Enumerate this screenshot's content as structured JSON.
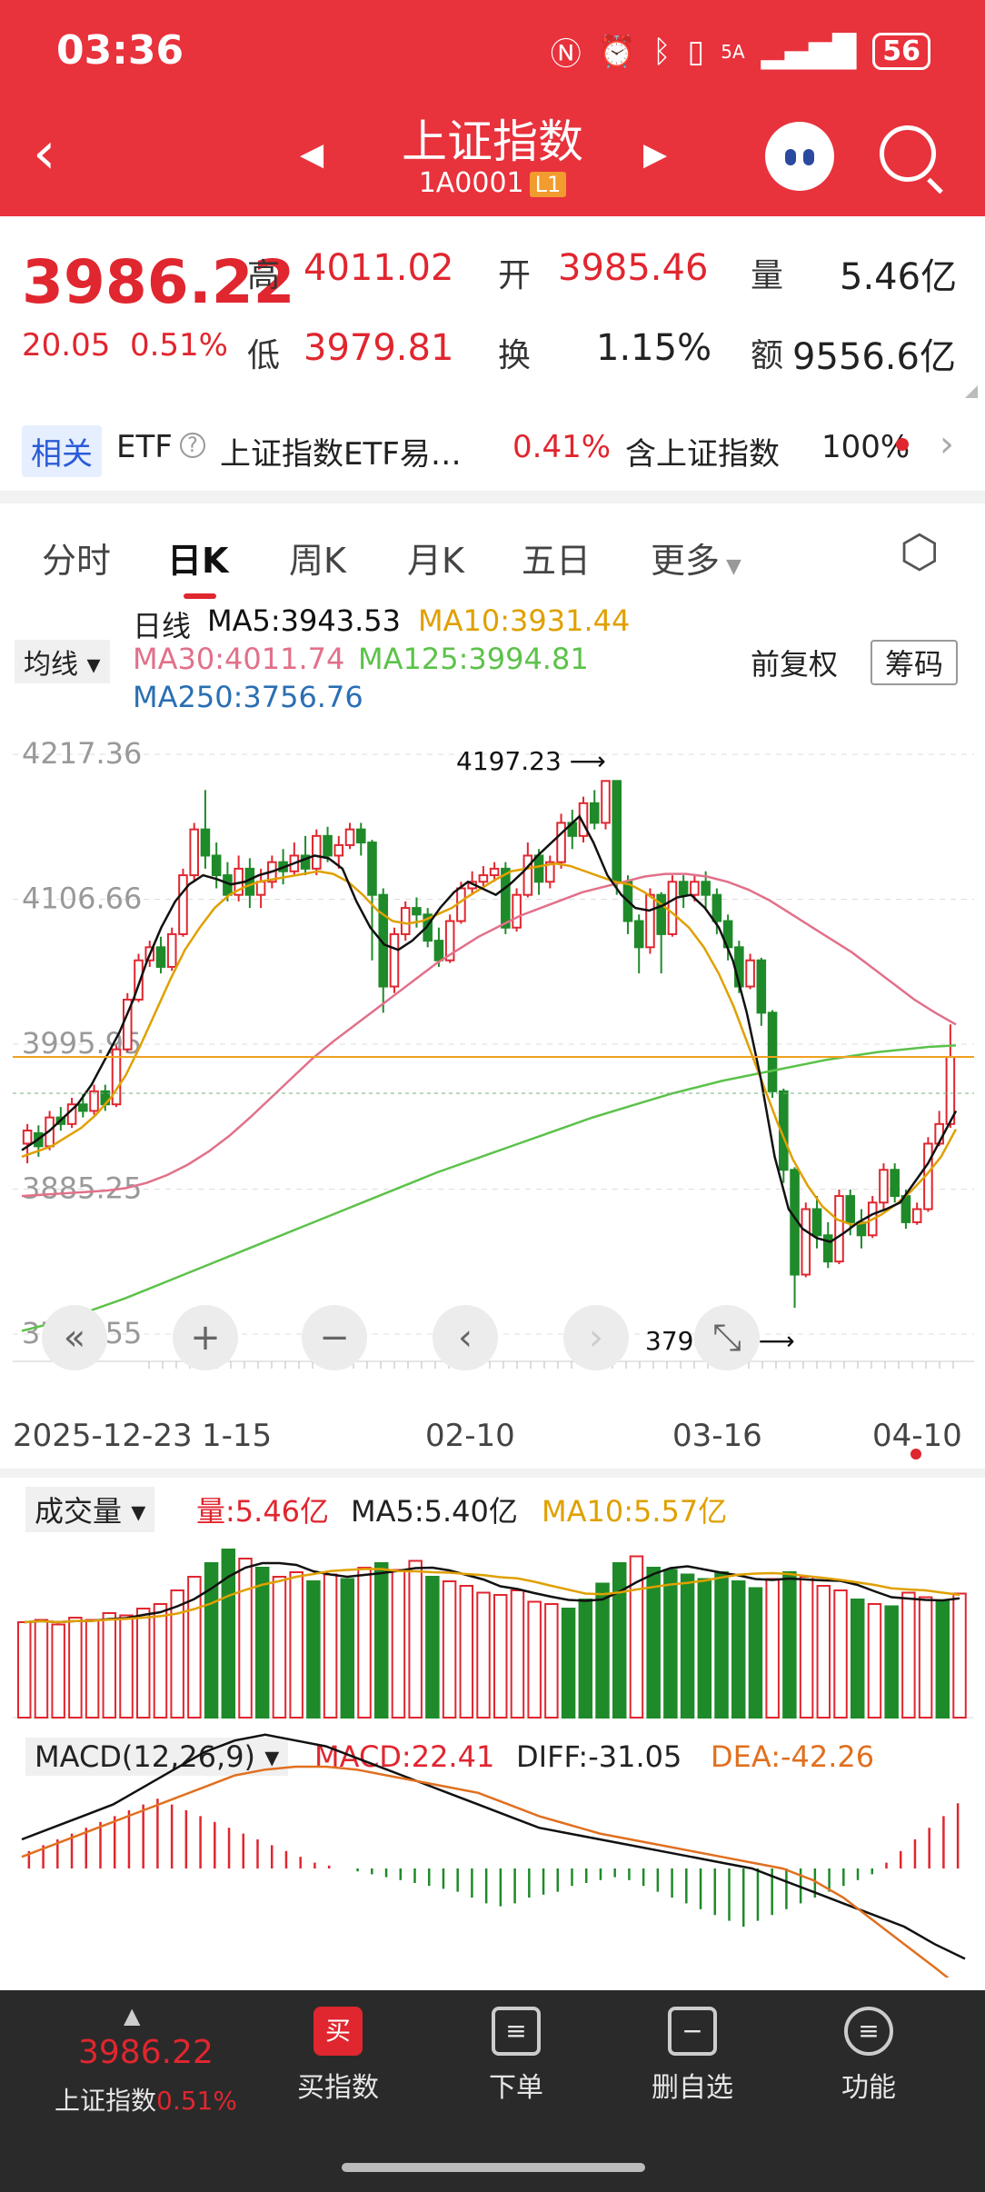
{
  "status": {
    "time": "03:36",
    "icons": [
      "nfc-icon",
      "alarm-icon",
      "bluetooth-icon",
      "vibrate-icon",
      "signal-icon"
    ],
    "net": "5A",
    "battery": "56"
  },
  "header": {
    "title": "上证指数",
    "code": "1A0001",
    "level": "L1"
  },
  "quote": {
    "price": "3986.22",
    "change": "20.05",
    "change_pct": "0.51%",
    "high_label": "高",
    "high": "4011.02",
    "open_label": "开",
    "open": "3985.46",
    "vol_label": "量",
    "vol": "5.46亿",
    "low_label": "低",
    "low": "3979.81",
    "turn_label": "换",
    "turn": "1.15%",
    "amt_label": "额",
    "amt": "9556.6亿"
  },
  "related": {
    "tag": "相关",
    "etf": "ETF",
    "name": "上证指数ETF易…",
    "pct": "0.41%",
    "contains": "含上证指数",
    "weight": "100%"
  },
  "tabs": [
    "分时",
    "日K",
    "周K",
    "月K",
    "五日",
    "更多"
  ],
  "legend": {
    "line_label": "日线",
    "ma5": "MA5:3943.53",
    "ma10": "MA10:3931.44",
    "ma30": "MA30:4011.74",
    "ma125": "MA125:3994.81",
    "ma250": "MA250:3756.76",
    "ma_select": "均线",
    "adjust": "前复权",
    "chips": "筹码"
  },
  "colors": {
    "up": "#e0262f",
    "down": "#1f8a2a",
    "ma5": "#111111",
    "ma10": "#e0a000",
    "ma30": "#e2708a",
    "ma125": "#5cc24a",
    "ma250": "#2a6fb3",
    "header": "#e8323c"
  },
  "chart_data": [
    {
      "type": "candlestick",
      "title": "上证指数 日K",
      "y_ticks": [
        "4217.36",
        "4106.66",
        "3995.95",
        "3885.25",
        "3774.55"
      ],
      "ylim": [
        3774.55,
        4217.36
      ],
      "x_labels": [
        "2025-12-23",
        "1-15",
        "02-10",
        "03-16",
        "04-10"
      ],
      "annotations": [
        {
          "text": "4197.23",
          "value": 4197.23
        },
        {
          "text": "3794.68",
          "value": 3794.68
        }
      ],
      "last_price_line": 3986.22,
      "candles": [
        [
          3920,
          3930,
          3905,
          3935
        ],
        [
          3928,
          3918,
          3910,
          3934
        ],
        [
          3918,
          3940,
          3915,
          3945
        ],
        [
          3940,
          3935,
          3930,
          3948
        ],
        [
          3935,
          3950,
          3932,
          3955
        ],
        [
          3950,
          3945,
          3940,
          3958
        ],
        [
          3945,
          3960,
          3942,
          3965
        ],
        [
          3960,
          3950,
          3945,
          3965
        ],
        [
          3950,
          3992,
          3948,
          3995
        ],
        [
          3992,
          4030,
          3990,
          4035
        ],
        [
          4030,
          4060,
          4028,
          4065
        ],
        [
          4060,
          4070,
          4055,
          4075
        ],
        [
          4070,
          4055,
          4050,
          4078
        ],
        [
          4055,
          4080,
          4052,
          4085
        ],
        [
          4080,
          4125,
          4078,
          4130
        ],
        [
          4125,
          4160,
          4120,
          4165
        ],
        [
          4160,
          4140,
          4130,
          4190
        ],
        [
          4140,
          4125,
          4115,
          4150
        ],
        [
          4125,
          4110,
          4105,
          4135
        ],
        [
          4110,
          4130,
          4105,
          4140
        ],
        [
          4130,
          4110,
          4100,
          4138
        ],
        [
          4110,
          4120,
          4100,
          4130
        ],
        [
          4120,
          4135,
          4115,
          4140
        ],
        [
          4135,
          4128,
          4118,
          4145
        ],
        [
          4128,
          4140,
          4125,
          4150
        ],
        [
          4140,
          4130,
          4125,
          4155
        ],
        [
          4130,
          4155,
          4125,
          4160
        ],
        [
          4155,
          4140,
          4135,
          4162
        ],
        [
          4140,
          4148,
          4130,
          4155
        ],
        [
          4148,
          4160,
          4145,
          4165
        ],
        [
          4160,
          4150,
          4140,
          4165
        ],
        [
          4150,
          4110,
          4060,
          4152
        ],
        [
          4110,
          4040,
          4020,
          4115
        ],
        [
          4040,
          4080,
          4035,
          4085
        ],
        [
          4080,
          4100,
          4075,
          4105
        ],
        [
          4100,
          4095,
          4085,
          4108
        ],
        [
          4095,
          4075,
          4070,
          4100
        ],
        [
          4075,
          4060,
          4055,
          4085
        ],
        [
          4060,
          4090,
          4058,
          4095
        ],
        [
          4090,
          4115,
          4088,
          4120
        ],
        [
          4115,
          4120,
          4110,
          4128
        ],
        [
          4120,
          4125,
          4115,
          4132
        ],
        [
          4125,
          4130,
          4120,
          4135
        ],
        [
          4130,
          4085,
          4080,
          4135
        ],
        [
          4085,
          4110,
          4082,
          4115
        ],
        [
          4110,
          4140,
          4108,
          4150
        ],
        [
          4140,
          4120,
          4110,
          4145
        ],
        [
          4120,
          4135,
          4115,
          4140
        ],
        [
          4135,
          4165,
          4130,
          4172
        ],
        [
          4165,
          4155,
          4145,
          4175
        ],
        [
          4155,
          4180,
          4150,
          4185
        ],
        [
          4180,
          4165,
          4160,
          4190
        ],
        [
          4165,
          4197,
          4160,
          4197
        ],
        [
          4197,
          4120,
          4110,
          4197
        ],
        [
          4120,
          4090,
          4080,
          4125
        ],
        [
          4090,
          4070,
          4050,
          4095
        ],
        [
          4070,
          4110,
          4065,
          4115
        ],
        [
          4110,
          4080,
          4050,
          4112
        ],
        [
          4080,
          4120,
          4078,
          4125
        ],
        [
          4120,
          4110,
          4100,
          4125
        ],
        [
          4110,
          4120,
          4105,
          4125
        ],
        [
          4120,
          4110,
          4100,
          4128
        ],
        [
          4110,
          4090,
          4080,
          4115
        ],
        [
          4090,
          4070,
          4060,
          4095
        ],
        [
          4070,
          4040,
          4035,
          4075
        ],
        [
          4040,
          4060,
          4038,
          4065
        ],
        [
          4060,
          4020,
          4010,
          4062
        ],
        [
          4020,
          3960,
          3955,
          4022
        ],
        [
          3960,
          3900,
          3890,
          3962
        ],
        [
          3900,
          3820,
          3794.68,
          3902
        ],
        [
          3820,
          3870,
          3818,
          3875
        ],
        [
          3870,
          3850,
          3840,
          3880
        ],
        [
          3850,
          3830,
          3825,
          3860
        ],
        [
          3830,
          3880,
          3828,
          3885
        ],
        [
          3880,
          3860,
          3850,
          3885
        ],
        [
          3860,
          3850,
          3840,
          3870
        ],
        [
          3850,
          3875,
          3848,
          3880
        ],
        [
          3875,
          3900,
          3870,
          3905
        ],
        [
          3900,
          3880,
          3875,
          3905
        ],
        [
          3880,
          3860,
          3855,
          3885
        ],
        [
          3860,
          3870,
          3858,
          3875
        ],
        [
          3870,
          3920,
          3868,
          3925
        ],
        [
          3920,
          3935,
          3918,
          3945
        ],
        [
          3935,
          3986.22,
          3932,
          4011.02
        ]
      ],
      "ma5": [
        3915,
        3922,
        3930,
        3940,
        3950,
        3965,
        3985,
        4005,
        4030,
        4060,
        4085,
        4105,
        4118,
        4125,
        4122,
        4118,
        4120,
        4125,
        4128,
        4132,
        4136,
        4140,
        4138,
        4130,
        4105,
        4085,
        4072,
        4068,
        4075,
        4085,
        4100,
        4112,
        4120,
        4115,
        4110,
        4118,
        4128,
        4140,
        4150,
        4160,
        4170,
        4150,
        4125,
        4110,
        4100,
        4098,
        4102,
        4108,
        4110,
        4100,
        4085,
        4060,
        4020,
        3970,
        3910,
        3870,
        3855,
        3848,
        3845,
        3852,
        3860,
        3866,
        3870,
        3875,
        3890,
        3905,
        3925,
        3945
      ],
      "ma10": [
        3910,
        3914,
        3918,
        3925,
        3932,
        3942,
        3955,
        3972,
        3995,
        4020,
        4045,
        4068,
        4085,
        4100,
        4110,
        4116,
        4120,
        4122,
        4124,
        4126,
        4128,
        4126,
        4120,
        4110,
        4098,
        4090,
        4088,
        4090,
        4095,
        4100,
        4108,
        4115,
        4122,
        4128,
        4130,
        4132,
        4134,
        4132,
        4128,
        4124,
        4120,
        4118,
        4112,
        4104,
        4095,
        4085,
        4070,
        4050,
        4025,
        3995,
        3965,
        3935,
        3908,
        3888,
        3872,
        3862,
        3858,
        3860,
        3866,
        3874,
        3884,
        3896,
        3910,
        3931
      ],
      "ma30": [
        3880,
        3881,
        3882,
        3883,
        3884,
        3886,
        3890,
        3896,
        3904,
        3914,
        3926,
        3940,
        3955,
        3970,
        3985,
        3998,
        4010,
        4022,
        4034,
        4046,
        4058,
        4068,
        4078,
        4086,
        4094,
        4100,
        4106,
        4112,
        4116,
        4120,
        4124,
        4126,
        4126,
        4124,
        4120,
        4114,
        4106,
        4096,
        4086,
        4076,
        4066,
        4054,
        4042,
        4030,
        4020,
        4011
      ],
      "ma125": [
        3777,
        3782,
        3788,
        3795,
        3802,
        3810,
        3818,
        3826,
        3834,
        3842,
        3850,
        3858,
        3866,
        3874,
        3882,
        3890,
        3898,
        3905,
        3912,
        3919,
        3926,
        3933,
        3940,
        3946,
        3952,
        3958,
        3963,
        3968,
        3972,
        3976,
        3980,
        3984,
        3987,
        3990,
        3992,
        3994,
        3995
      ],
      "ma250": [
        3756.76
      ]
    },
    {
      "type": "bar",
      "title": "成交量",
      "label": "成交量",
      "vol": "量:5.46亿",
      "ma5": "MA5:5.40亿",
      "ma10": "MA10:5.57亿",
      "values": [
        4.2,
        4.3,
        4.1,
        4.4,
        4.3,
        4.6,
        4.5,
        4.8,
        5.0,
        5.6,
        6.2,
        6.8,
        7.4,
        7.0,
        6.6,
        6.2,
        6.4,
        6.0,
        6.3,
        6.1,
        6.6,
        6.8,
        6.5,
        6.9,
        6.2,
        6.0,
        5.8,
        5.5,
        5.4,
        5.6,
        5.1,
        5.0,
        4.8,
        5.2,
        5.9,
        6.8,
        7.1,
        6.6,
        6.5,
        6.3,
        6.1,
        6.4,
        6.0,
        5.7,
        6.1,
        6.4,
        6.2,
        5.8,
        5.6,
        5.2,
        5.0,
        4.9,
        5.5,
        5.3,
        5.1,
        5.46
      ],
      "up": [
        1,
        1,
        1,
        1,
        1,
        1,
        1,
        1,
        1,
        1,
        1,
        0,
        0,
        1,
        0,
        1,
        1,
        0,
        1,
        0,
        1,
        0,
        1,
        1,
        0,
        1,
        1,
        1,
        1,
        1,
        1,
        1,
        0,
        0,
        0,
        0,
        1,
        0,
        0,
        0,
        0,
        0,
        0,
        0,
        1,
        0,
        1,
        1,
        1,
        0,
        1,
        0,
        1,
        1,
        0,
        1
      ]
    },
    {
      "type": "bar",
      "title": "MACD",
      "label": "MACD(12,26,9)",
      "macd": "MACD:22.41",
      "diff": "DIFF:-31.05",
      "dea": "DEA:-42.26",
      "hist": [
        6,
        8,
        10,
        12,
        14,
        16,
        18,
        20,
        22,
        24,
        22,
        20,
        18,
        16,
        14,
        12,
        10,
        8,
        6,
        4,
        2,
        1,
        0,
        -1,
        -2,
        -3,
        -4,
        -5,
        -6,
        -7,
        -8,
        -10,
        -12,
        -13,
        -12,
        -10,
        -9,
        -8,
        -6,
        -5,
        -4,
        -3,
        -4,
        -6,
        -8,
        -10,
        -12,
        -14,
        -16,
        -18,
        -20,
        -18,
        -16,
        -14,
        -12,
        -10,
        -8,
        -6,
        -4,
        -2,
        2,
        6,
        10,
        14,
        18,
        22.41
      ],
      "diff_line": [
        10,
        14,
        18,
        22,
        28,
        34,
        40,
        44,
        46,
        44,
        42,
        38,
        34,
        30,
        26,
        22,
        18,
        14,
        12,
        10,
        8,
        6,
        4,
        2,
        0,
        -4,
        -8,
        -12,
        -16,
        -20,
        -26,
        -31.05
      ],
      "dea_line": [
        4,
        8,
        12,
        16,
        20,
        24,
        28,
        32,
        34,
        35,
        35,
        34,
        32,
        30,
        28,
        26,
        22,
        18,
        15,
        12,
        10,
        8,
        6,
        4,
        2,
        0,
        -4,
        -10,
        -18,
        -26,
        -34,
        -42.26
      ]
    }
  ],
  "bottom": {
    "price": "3986.22",
    "name": "上证指数",
    "pct": "0.51%",
    "buy": "买指数",
    "order": "下单",
    "remove": "删自选",
    "func": "功能"
  }
}
